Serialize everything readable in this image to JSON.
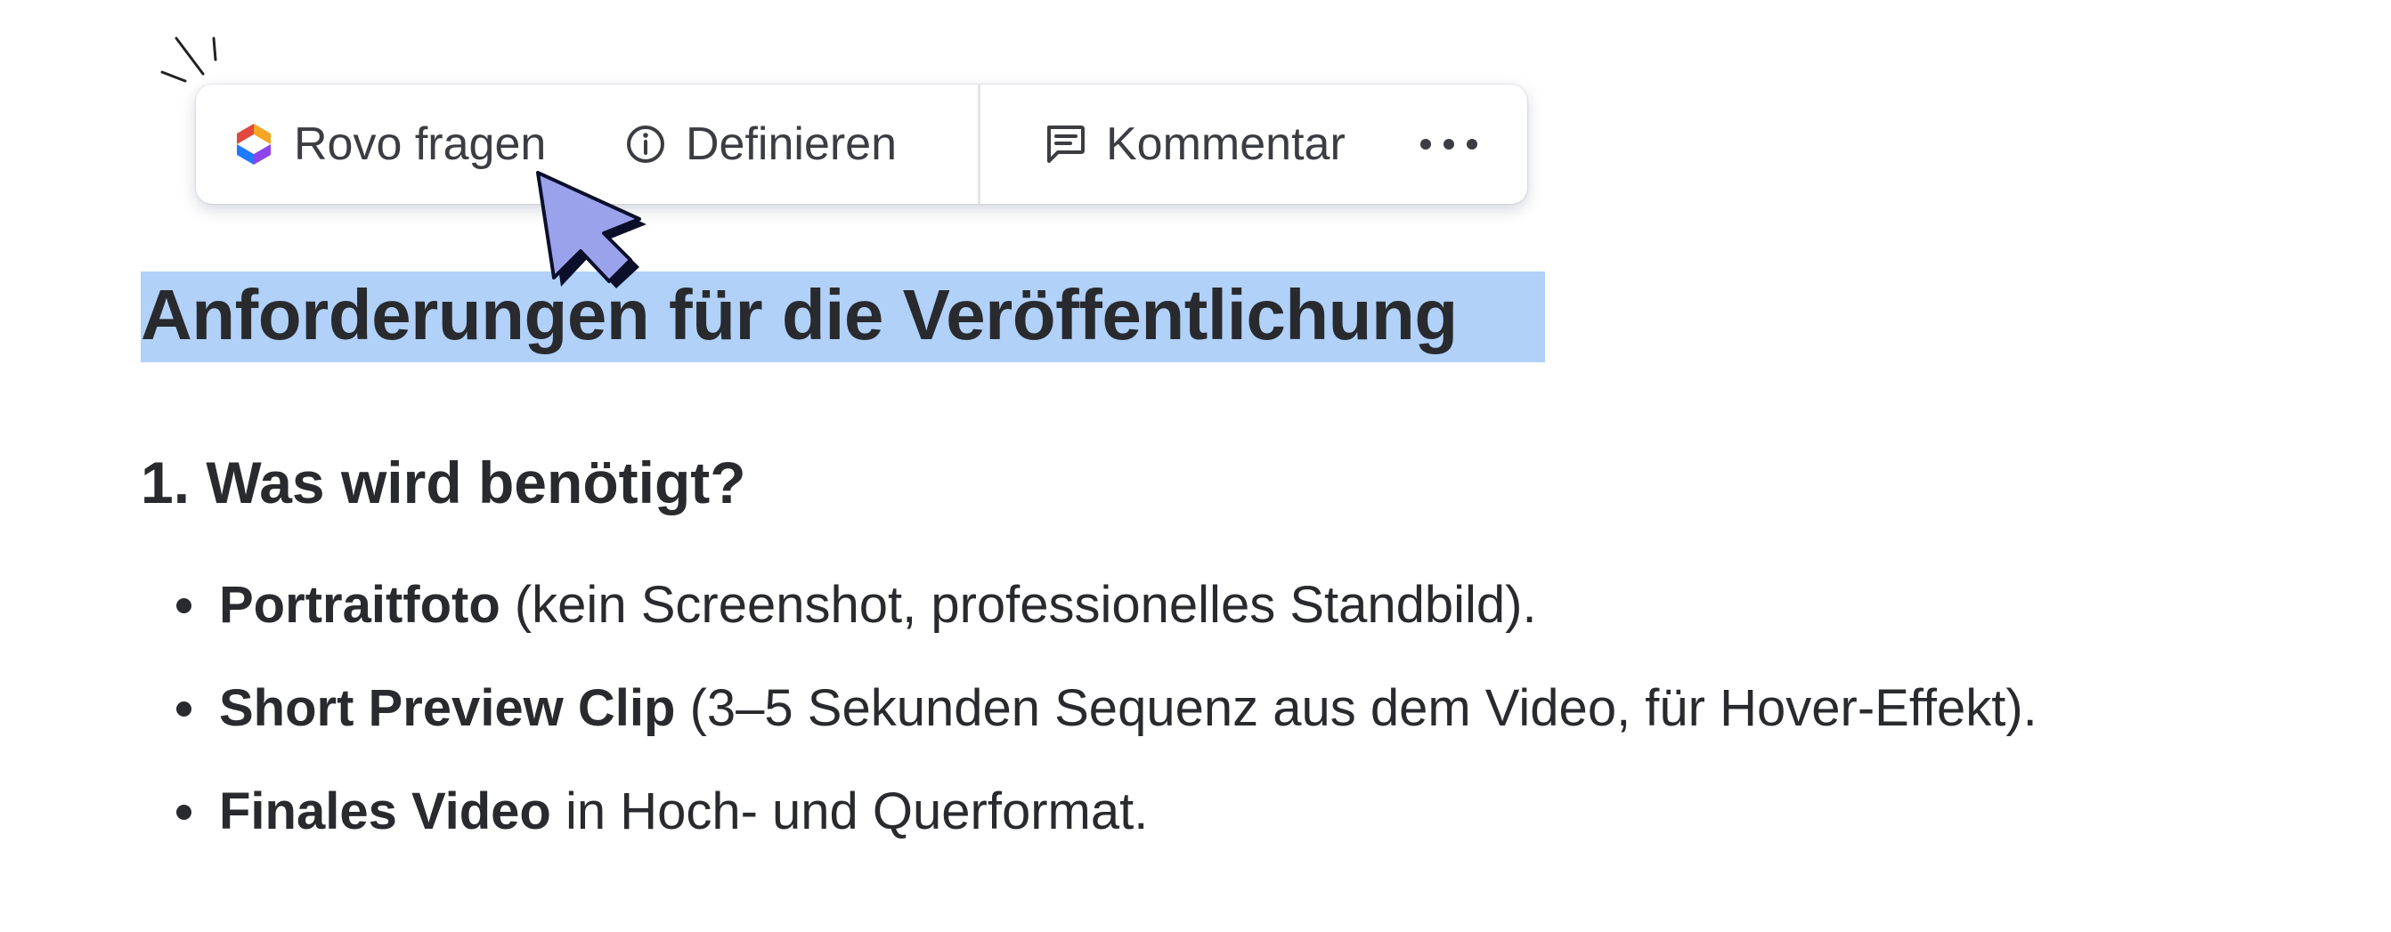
{
  "toolbar": {
    "ask_rovo": "Rovo fragen",
    "define": "Definieren",
    "comment": "Kommentar",
    "more_icon": "ellipsis-icon"
  },
  "heading": "Anforderungen für die Veröffentlichung",
  "section": "1. Was wird benötigt?",
  "bullets": [
    {
      "bold": "Portraitfoto",
      "rest": " (kein Screenshot, professionelles Standbild)."
    },
    {
      "bold": "Short Preview Clip",
      "rest": " (3–5 Sekunden Sequenz aus dem Video, für Hover-Effekt)."
    },
    {
      "bold": "Finales Video",
      "rest": " in Hoch- und Querformat."
    }
  ],
  "colors": {
    "selection": "#b1d1f9",
    "text": "#292a2e",
    "cursor_fill": "#9aa2ec",
    "cursor_shadow": "#0b0f2a"
  }
}
